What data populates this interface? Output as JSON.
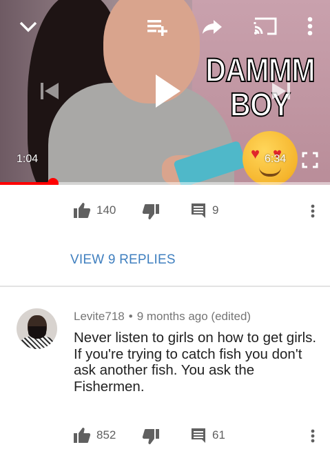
{
  "player": {
    "overlay_title_lines": [
      "DAMMM",
      "BOY"
    ],
    "current_time": "1:04",
    "duration": "6:34",
    "progress_fraction": 0.16,
    "icons": [
      "chevron-down-icon",
      "add-to-queue-icon",
      "share-icon",
      "cast-icon",
      "more-vert-icon",
      "previous-icon",
      "play-icon",
      "next-icon",
      "fullscreen-icon"
    ],
    "accent_color": "#ff0000"
  },
  "comment_prev": {
    "likes": "140",
    "replies_count": "9",
    "view_replies_label": "VIEW 9 REPLIES"
  },
  "comment": {
    "author": "Levite718",
    "separator": "•",
    "time": "9 months ago (edited)",
    "text_lines": [
      "Never listen to girls on how to get girls.",
      "If you're trying to catch fish you don't ask another fish. You ask the Fishermen."
    ],
    "likes": "852",
    "replies_count": "61"
  },
  "colors": {
    "link_blue": "#3f7fbf",
    "meta_gray": "#757575",
    "icon_gray": "#606060"
  }
}
